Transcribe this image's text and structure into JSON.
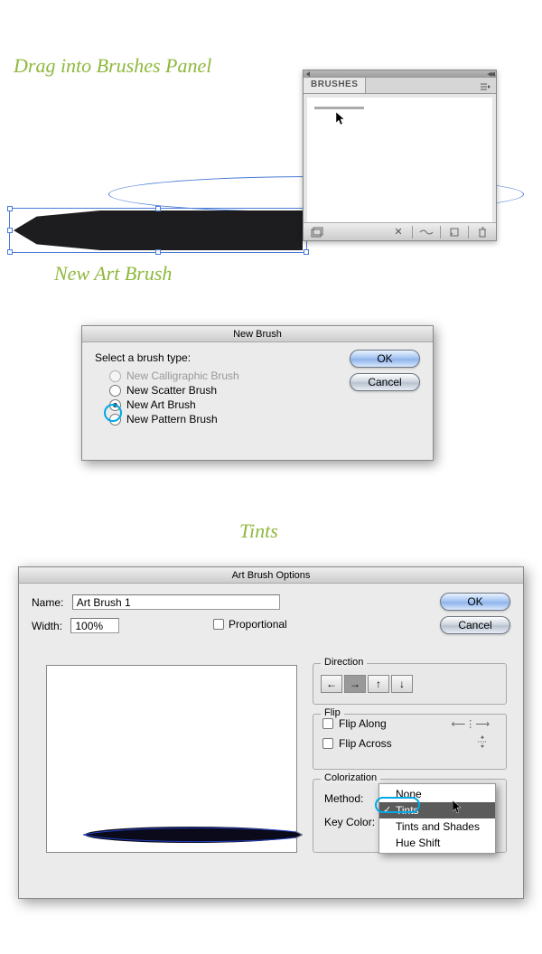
{
  "headings": {
    "step1": "Drag into Brushes Panel",
    "step2": "New Art Brush",
    "step3": "Tints"
  },
  "brushes_panel": {
    "tab_label": "BRUSHES"
  },
  "new_brush_dialog": {
    "title": "New Brush",
    "prompt": "Select a brush type:",
    "options": {
      "calligraphic": "New Calligraphic Brush",
      "scatter": "New Scatter Brush",
      "art": "New Art Brush",
      "pattern": "New Pattern Brush"
    },
    "ok": "OK",
    "cancel": "Cancel"
  },
  "art_brush_options": {
    "title": "Art Brush Options",
    "name_label": "Name:",
    "name_value": "Art Brush 1",
    "width_label": "Width:",
    "width_value": "100%",
    "proportional_label": "Proportional",
    "ok": "OK",
    "cancel": "Cancel",
    "direction": {
      "legend": "Direction",
      "left": "←",
      "right": "→",
      "up": "↑",
      "down": "↓"
    },
    "flip": {
      "legend": "Flip",
      "along": "Flip Along",
      "across": "Flip Across"
    },
    "colorization": {
      "legend": "Colorization",
      "method_label": "Method:",
      "keycolor_label": "Key Color:",
      "options": {
        "none": "None",
        "tints": "Tints",
        "tints_shades": "Tints and Shades",
        "hue_shift": "Hue Shift"
      }
    }
  }
}
